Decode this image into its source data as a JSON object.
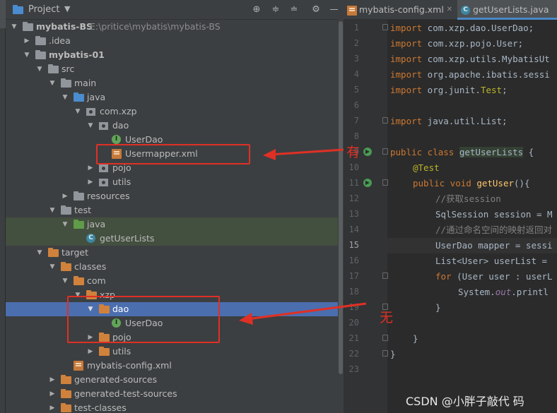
{
  "project_panel": {
    "title": "Project",
    "tree": [
      {
        "label": "mybatis-BS",
        "path": "E:\\pritice\\mybatis\\mybatis-BS"
      },
      {
        "label": ".idea"
      },
      {
        "label": "mybatis-01"
      },
      {
        "label": "src"
      },
      {
        "label": "main"
      },
      {
        "label": "java"
      },
      {
        "label": "com.xzp"
      },
      {
        "label": "dao"
      },
      {
        "label": "UserDao"
      },
      {
        "label": "Usermapper.xml"
      },
      {
        "label": "pojo"
      },
      {
        "label": "utils"
      },
      {
        "label": "resources"
      },
      {
        "label": "test"
      },
      {
        "label": "java"
      },
      {
        "label": "getUserLists"
      },
      {
        "label": "target"
      },
      {
        "label": "classes"
      },
      {
        "label": "com"
      },
      {
        "label": "xzp"
      },
      {
        "label": "dao"
      },
      {
        "label": "UserDao"
      },
      {
        "label": "pojo"
      },
      {
        "label": "utils"
      },
      {
        "label": "mybatis-config.xml"
      },
      {
        "label": "generated-sources"
      },
      {
        "label": "generated-test-sources"
      },
      {
        "label": "test-classes"
      }
    ]
  },
  "editor": {
    "tabs": [
      {
        "label": "mybatis-config.xml"
      },
      {
        "label": "getUserLists.java"
      }
    ],
    "line_numbers": [
      "1",
      "2",
      "3",
      "4",
      "5",
      "6",
      "7",
      "8",
      "9",
      "10",
      "11",
      "12",
      "13",
      "14",
      "15",
      "16",
      "17",
      "18",
      "19",
      "20",
      "21",
      "22",
      "23"
    ],
    "code": {
      "l1a": "import",
      "l1b": " com.xzp.dao.UserDao;",
      "l2a": "import",
      "l2b": " com.xzp.pojo.User;",
      "l3a": "import",
      "l3b": " com.xzp.utils.MybatisUt",
      "l4a": "import",
      "l4b": " org.apache.ibatis.sessi",
      "l5a": "import",
      "l5b": " org.junit.",
      "l5c": "Test",
      "l5d": ";",
      "l7a": "import",
      "l7b": " java.util.List;",
      "l9a": "public class ",
      "l9b": "getUserLists",
      "l9c": " {",
      "l10": "@Test",
      "l11a": "public void ",
      "l11b": "getUser",
      "l11c": "(){",
      "l12": "//获取session",
      "l13": "SqlSession session = M",
      "l14": "//通过命名空间的映射返回对",
      "l15": "UserDao mapper = sessi",
      "l16": "List<User> userList = ",
      "l17a": "for",
      "l17b": " (User user : userL",
      "l18a": "System.",
      "l18b": "out",
      "l18c": ".printl",
      "l19": "}",
      "l21": "}",
      "l22": "}"
    }
  },
  "annotations": {
    "has": "有",
    "none": "无"
  },
  "watermark": "CSDN @小胖子敲代 码",
  "colors": {
    "annotation_red": "#e03025",
    "selection_blue": "#4b6eaf",
    "test_green": "#434f3f"
  }
}
